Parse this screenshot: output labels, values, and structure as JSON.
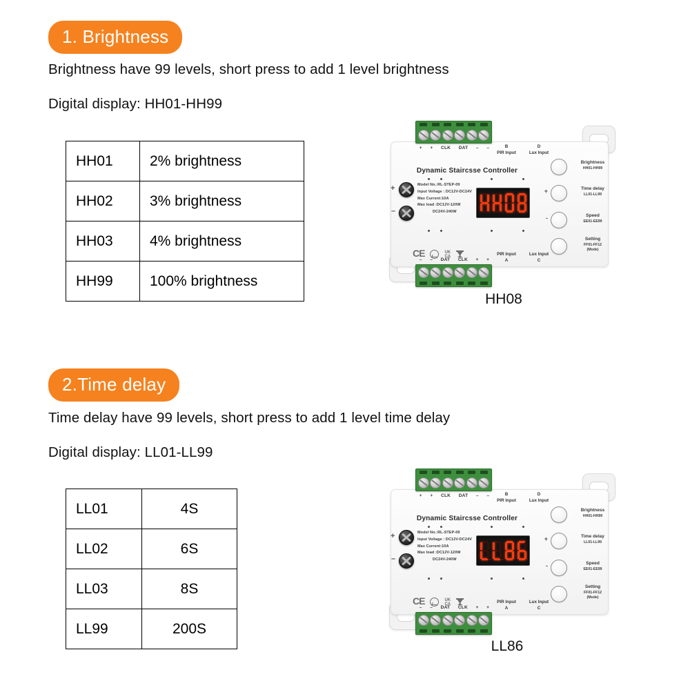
{
  "sections": [
    {
      "badge": "1. Brightness",
      "line1": "Brightness have 99 levels, short press to add 1 level brightness",
      "line2": "Digital display: HH01-HH99",
      "table": {
        "rows": [
          {
            "code": "HH01",
            "value": "2% brightness"
          },
          {
            "code": "HH02",
            "value": "3% brightness"
          },
          {
            "code": "HH03",
            "value": "4% brightness"
          },
          {
            "code": "HH99",
            "value": "100% brightness"
          }
        ]
      },
      "device_caption": "HH08",
      "display_value": "HH08"
    },
    {
      "badge": "2.Time delay",
      "line1": "Time delay have 99 levels, short press to add 1 level time delay",
      "line2": "Digital display: LL01-LL99",
      "table": {
        "rows": [
          {
            "code": "LL01",
            "value": "4S"
          },
          {
            "code": "LL02",
            "value": "6S"
          },
          {
            "code": "LL03",
            "value": "8S"
          },
          {
            "code": "LL99",
            "value": "200S"
          }
        ]
      },
      "device_caption": "LL86",
      "display_value": "LL86"
    }
  ],
  "device": {
    "title": "Dynamic Staircsse Controller",
    "terminal_top_pins": [
      "+",
      "+",
      "CLK",
      "DAT",
      "–",
      "–"
    ],
    "terminal_bottom_pins": [
      "–",
      "–",
      "DAT",
      "CLK",
      "+",
      "+"
    ],
    "io_top": [
      {
        "letter": "B",
        "label": "PIR Input"
      },
      {
        "letter": "D",
        "label": "Lux Input"
      }
    ],
    "io_bottom": [
      {
        "label": "PIR Input",
        "letter": "A"
      },
      {
        "label": "Lux Input",
        "letter": "C"
      }
    ],
    "spec_lines": [
      "Model No.:RL-STEP-09",
      "Input Voltage : DC12V-DC24V",
      "Max Current:10A",
      "Max  load :DC12V-120W",
      "DC24V-240W"
    ],
    "terminal_signs": {
      "plus": "+",
      "minus": "–"
    },
    "buttons": [
      {
        "name": "Brightness",
        "range": "HH01-HH99",
        "note": ""
      },
      {
        "name": "Time delay",
        "range": "LL01-LL99",
        "note": ""
      },
      {
        "name": "Speed",
        "range": "EE01-EE99",
        "note": ""
      },
      {
        "name": "Setting",
        "range": "FF01-FF12",
        "note": "(Mode)"
      }
    ],
    "button_signs": {
      "plus": "+",
      "minus": "-"
    },
    "certs": [
      "CE",
      "RoHS",
      "UKCA",
      "WEEE"
    ],
    "colors": {
      "accent_orange": "#F5821F",
      "terminal_green": "#3d8f3d",
      "display_red": "#ff3a10",
      "body_white": "#f7f7f7"
    }
  }
}
